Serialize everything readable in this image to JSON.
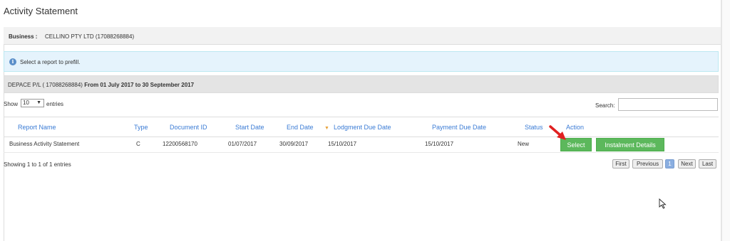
{
  "page": {
    "title": "Activity Statement"
  },
  "business": {
    "label": "Business :",
    "value": "CELLINO PTY LTD (17088268884)"
  },
  "info": {
    "message": "Select a report to prefill.",
    "icon": "info-icon"
  },
  "report": {
    "prefix": "DEPACE P/L ( 17088268884)",
    "period": "From 01 July 2017 to 30 September 2017"
  },
  "table_controls": {
    "show_label": "Show",
    "page_size": "10",
    "entries_label": "entries",
    "search_label": "Search:",
    "search_value": ""
  },
  "table": {
    "columns": [
      "Report Name",
      "Type",
      "Document ID",
      "Start Date",
      "End Date",
      "Lodgment Due Date",
      "Payment Due Date",
      "Status",
      "Action"
    ],
    "rows": [
      {
        "report_name": "Business Activity Statement",
        "type": "C",
        "document_id": "12200568170",
        "start_date": "01/07/2017",
        "end_date": "30/09/2017",
        "lodgment_due": "15/10/2017",
        "payment_due": "15/10/2017",
        "status": "New",
        "select_label": "Select",
        "instalment_label": "Instalment Details"
      }
    ]
  },
  "footer": {
    "summary": "Showing 1 to 1 of 1 entries",
    "pagination": {
      "first": "First",
      "previous": "Previous",
      "current": "1",
      "next": "Next",
      "last": "Last"
    }
  },
  "colors": {
    "header_link": "#3a7bd5",
    "button_green": "#5cb85c",
    "info_bg": "#e5f3fc",
    "sort_icon": "#e8a33d"
  }
}
